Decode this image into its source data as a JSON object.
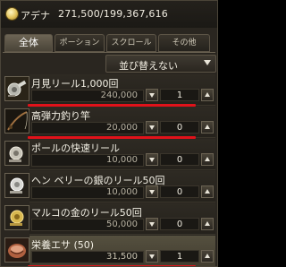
{
  "header": {
    "currency_name": "アデナ",
    "currency_amount": "271,500/199,367,616",
    "coin_icon": "adena-coin-icon"
  },
  "tabs": [
    {
      "label": "全体",
      "active": true
    },
    {
      "label": "ポーション",
      "active": false
    },
    {
      "label": "スクロール",
      "active": false
    },
    {
      "label": "その他",
      "active": false
    }
  ],
  "sort": {
    "label": "並び替えない"
  },
  "items": [
    {
      "name": "月見リール1,000回",
      "price": "240,000",
      "qty": "1",
      "icon": "reel-icon",
      "selected": false,
      "highlighted": true
    },
    {
      "name": "高弾力釣り竿",
      "price": "20,000",
      "qty": "0",
      "icon": "fishing-rod-icon",
      "selected": false,
      "highlighted": true
    },
    {
      "name": "ポールの快速リール",
      "price": "10,000",
      "qty": "0",
      "icon": "reel-icon",
      "selected": false,
      "highlighted": false
    },
    {
      "name": "ヘン ベリーの銀のリール50回",
      "price": "10,000",
      "qty": "0",
      "icon": "reel-icon",
      "selected": false,
      "highlighted": false
    },
    {
      "name": "マルコの金のリール50回",
      "price": "50,000",
      "qty": "0",
      "icon": "reel-icon",
      "selected": false,
      "highlighted": false
    },
    {
      "name": "栄養エサ (50)",
      "price": "31,500",
      "qty": "1",
      "icon": "bait-icon",
      "selected": true,
      "highlighted": true
    }
  ],
  "colors": {
    "highlight": "#e0121a",
    "background": "#2a2620",
    "selected_row": "#4d4839"
  }
}
